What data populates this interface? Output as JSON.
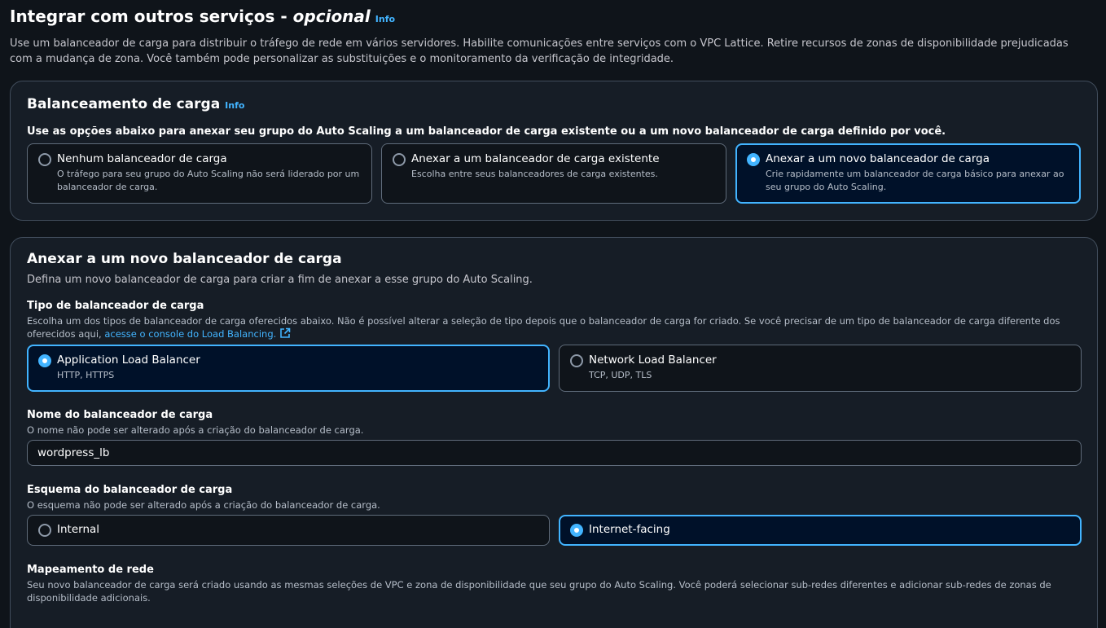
{
  "page": {
    "title": "Integrar com outros serviços - ",
    "title_optional": "opcional",
    "info": "Info",
    "description": "Use um balanceador de carga para distribuir o tráfego de rede em vários servidores. Habilite comunicações entre serviços com o VPC Lattice. Retire recursos de zonas de disponibilidade prejudicadas com a mudança de zona. Você também pode personalizar as substituições e o monitoramento da verificação de integridade."
  },
  "load_balancing": {
    "title": "Balanceamento de carga",
    "info": "Info",
    "prompt": "Use as opções abaixo para anexar seu grupo do Auto Scaling a um balanceador de carga existente ou a um novo balanceador de carga definido por você.",
    "options": [
      {
        "title": "Nenhum balanceador de carga",
        "description": "O tráfego para seu grupo do Auto Scaling não será liderado por um balanceador de carga.",
        "selected": false
      },
      {
        "title": "Anexar a um balanceador de carga existente",
        "description": "Escolha entre seus balanceadores de carga existentes.",
        "selected": false
      },
      {
        "title": "Anexar a um novo balanceador de carga",
        "description": "Crie rapidamente um balanceador de carga básico para anexar ao seu grupo do Auto Scaling.",
        "selected": true
      }
    ]
  },
  "new_lb": {
    "title": "Anexar a um novo balanceador de carga",
    "description": "Defina um novo balanceador de carga para criar a fim de anexar a esse grupo do Auto Scaling.",
    "type": {
      "label": "Tipo de balanceador de carga",
      "description": "Escolha um dos tipos de balanceador de carga oferecidos abaixo. Não é possível alterar a seleção de tipo depois que o balanceador de carga for criado. Se você precisar de um tipo de balanceador de carga diferente dos oferecidos aqui,",
      "link": "acesse o console do Load Balancing.",
      "options": [
        {
          "title": "Application Load Balancer",
          "description": "HTTP, HTTPS",
          "selected": true
        },
        {
          "title": "Network Load Balancer",
          "description": "TCP, UDP, TLS",
          "selected": false
        }
      ]
    },
    "name": {
      "label": "Nome do balanceador de carga",
      "description": "O nome não pode ser alterado após a criação do balanceador de carga.",
      "value": "wordpress_lb"
    },
    "scheme": {
      "label": "Esquema do balanceador de carga",
      "description": "O esquema não pode ser alterado após a criação do balanceador de carga.",
      "options": [
        {
          "title": "Internal",
          "selected": false
        },
        {
          "title": "Internet-facing",
          "selected": true
        }
      ]
    },
    "network": {
      "label": "Mapeamento de rede",
      "description": "Seu novo balanceador de carga será criado usando as mesmas seleções de VPC e zona de disponibilidade que seu grupo do Auto Scaling. Você poderá selecionar sub-redes diferentes e adicionar sub-redes de zonas de disponibilidade adicionais."
    }
  },
  "colors": {
    "accent": "#42b4ff",
    "background": "#0f141a",
    "container": "#161d26",
    "selected_tile": "#001129"
  }
}
